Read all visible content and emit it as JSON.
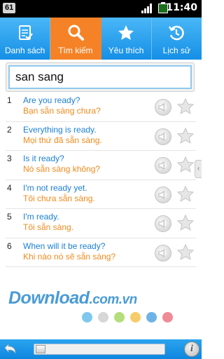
{
  "status_bar": {
    "badge": "61",
    "time": "11:40"
  },
  "tabs": [
    {
      "label": "Danh sách",
      "icon": "list-check-icon",
      "active": false
    },
    {
      "label": "Tìm kiếm",
      "icon": "search-icon",
      "active": true
    },
    {
      "label": "Yêu thích",
      "icon": "star-icon",
      "active": false
    },
    {
      "label": "Lịch sử",
      "icon": "history-icon",
      "active": false
    }
  ],
  "search": {
    "value": "san sang"
  },
  "results": [
    {
      "num": "1",
      "en": "Are you ready?",
      "vi": "Bạn sẵn sàng chưa?"
    },
    {
      "num": "2",
      "en": "Everything is ready.",
      "vi": "Mọi thứ đã sẵn sàng."
    },
    {
      "num": "3",
      "en": "Is it ready?",
      "vi": "Nó sẵn sàng không?"
    },
    {
      "num": "4",
      "en": "I'm not ready yet.",
      "vi": "Tôi chưa sẵn sàng."
    },
    {
      "num": "5",
      "en": "I'm ready.",
      "vi": "Tôi sẵn sàng."
    },
    {
      "num": "6",
      "en": "When will it be ready?",
      "vi": "Khi nào nó sẽ sẵn sàng?"
    }
  ],
  "watermark": {
    "main": "Download",
    "suffix": ".com.vn"
  },
  "dot_colors": [
    "#7ec8f0",
    "#d7d7d7",
    "#b3de7a",
    "#f6cc6a",
    "#6fb3e6",
    "#f08a96"
  ],
  "colors": {
    "tab_bar": "#1f9ef2",
    "tab_active": "#f58226",
    "english_text": "#1a7fd6",
    "vietnamese_text": "#f08a1c"
  },
  "bottom_bar": {
    "info_label": "i",
    "progress": 0.0
  }
}
